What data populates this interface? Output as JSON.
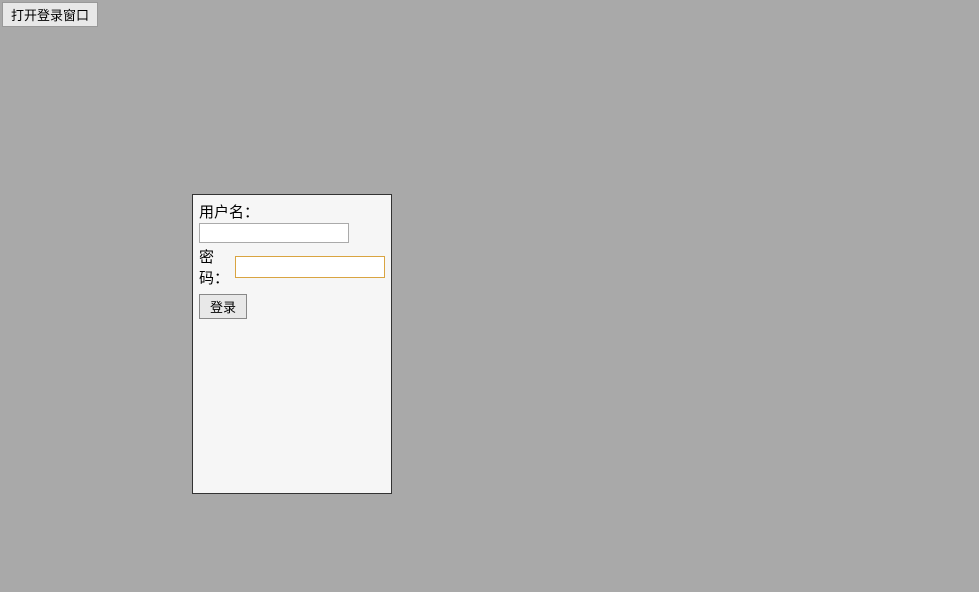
{
  "top_button": {
    "label": "打开登录窗口"
  },
  "login_form": {
    "username_label": "用户名：",
    "username_value": "",
    "password_label": "密码：",
    "password_value": "",
    "login_button_label": "登录"
  }
}
